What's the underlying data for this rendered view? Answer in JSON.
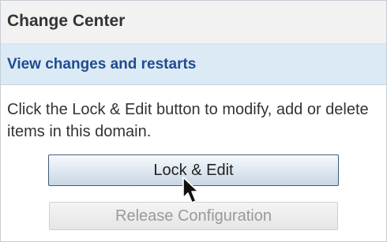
{
  "panel": {
    "title": "Change Center",
    "subheader_link": "View changes and restarts",
    "description": "Click the Lock & Edit button to modify, add or delete items in this domain.",
    "lock_edit_label": "Lock & Edit",
    "release_label": "Release Configuration"
  },
  "icons": {
    "cursor": "mouse-pointer-icon"
  },
  "colors": {
    "header_bg": "#f2f2f2",
    "subheader_bg": "#dceaf5",
    "link": "#1f4c8f",
    "disabled_text": "#9a9a9a"
  }
}
